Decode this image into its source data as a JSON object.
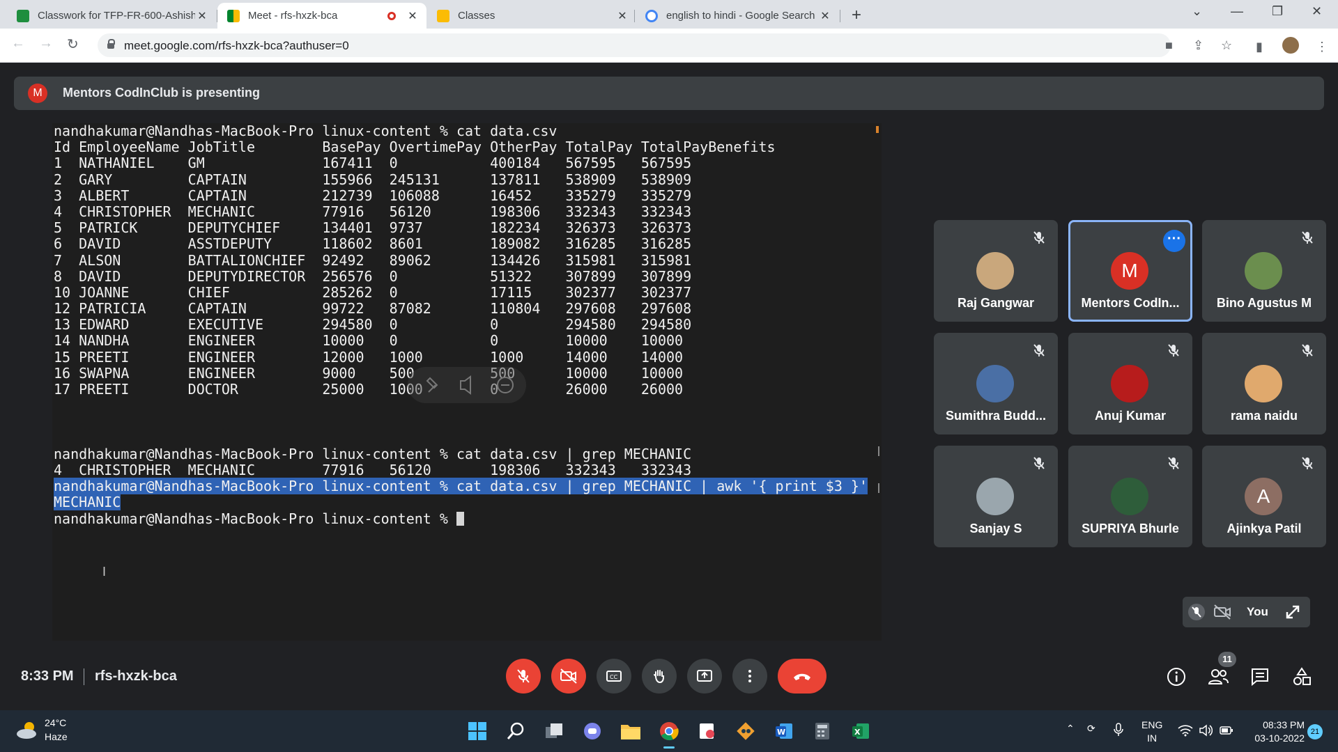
{
  "browser": {
    "tabs": [
      {
        "title": "Classwork for TFP-FR-600-Ashish",
        "close": "✕",
        "favicon_color": "#1e8e3e"
      },
      {
        "title": "Meet - rfs-hxzk-bca",
        "close": "✕",
        "favicon_color": "#00832d"
      },
      {
        "title": "Classes",
        "close": "✕",
        "favicon_color": "#fbbc04"
      },
      {
        "title": "english to hindi - Google Search",
        "close": "✕",
        "favicon_color": "#4285f4"
      }
    ],
    "new_tab": "+",
    "url": "meet.google.com/rfs-hxzk-bca?authuser=0"
  },
  "meet": {
    "presenting_avatar": "M",
    "presenting_text": "Mentors CodInClub is presenting",
    "terminal_lines": [
      "nandhakumar@Nandhas-MacBook-Pro linux-content % cat data.csv",
      "Id EmployeeName JobTitle        BasePay OvertimePay OtherPay TotalPay TotalPayBenefits",
      "1  NATHANIEL    GM              167411  0           400184   567595   567595",
      "2  GARY         CAPTAIN         155966  245131      137811   538909   538909",
      "3  ALBERT       CAPTAIN         212739  106088      16452    335279   335279",
      "4  CHRISTOPHER  MECHANIC        77916   56120       198306   332343   332343",
      "5  PATRICK      DEPUTYCHIEF     134401  9737        182234   326373   326373",
      "6  DAVID        ASSTDEPUTY      118602  8601        189082   316285   316285",
      "7  ALSON        BATTALIONCHIEF  92492   89062       134426   315981   315981",
      "8  DAVID        DEPUTYDIRECTOR  256576  0           51322    307899   307899",
      "10 JOANNE       CHIEF           285262  0           17115    302377   302377",
      "12 PATRICIA     CAPTAIN         99722   87082       110804   297608   297608",
      "13 EDWARD       EXECUTIVE       294580  0           0        294580   294580",
      "14 NANDHA       ENGINEER        10000   0           0        10000    10000",
      "15 PREETI       ENGINEER        12000   1000        1000     14000    14000",
      "16 SWAPNA       ENGINEER        9000    500         500      10000    10000",
      "17 PREETI       DOCTOR          25000   1000        0        26000    26000",
      "",
      "",
      "",
      "nandhakumar@Nandhas-MacBook-Pro linux-content % cat data.csv | grep MECHANIC",
      "4  CHRISTOPHER  MECHANIC        77916   56120       198306   332343   332343",
      "nandhakumar@Nandhas-MacBook-Pro linux-content % cat data.csv | grep MECHANIC | awk '{ print $3 }'",
      "MECHANIC",
      "nandhakumar@Nandhas-MacBook-Pro linux-content % "
    ],
    "participants": [
      {
        "name": "Raj Gangwar",
        "color": "#c9a77c"
      },
      {
        "name": "Mentors CodIn...",
        "color": "#d93025",
        "letter": "M"
      },
      {
        "name": "Bino Agustus M",
        "color": "#6b8e4e"
      },
      {
        "name": "Sumithra Budd...",
        "color": "#4a6fa5"
      },
      {
        "name": "Anuj Kumar",
        "color": "#b71c1c"
      },
      {
        "name": "rama naidu",
        "color": "#e0a96d"
      },
      {
        "name": "Sanjay S",
        "color": "#9aa6ad"
      },
      {
        "name": "SUPRIYA Bhurle",
        "color": "#2e5d3a"
      },
      {
        "name": "Ajinkya Patil",
        "color": "#8d6e63",
        "letter": "A"
      }
    ],
    "self_label": "You",
    "time": "8:33 PM",
    "meeting_code": "rfs-hxzk-bca",
    "people_count": "11"
  },
  "taskbar": {
    "temp": "24°C",
    "condition": "Haze",
    "lang_1": "ENG",
    "lang_2": "IN",
    "time": "08:33 PM",
    "date": "03-10-2022",
    "notifications": "21"
  }
}
